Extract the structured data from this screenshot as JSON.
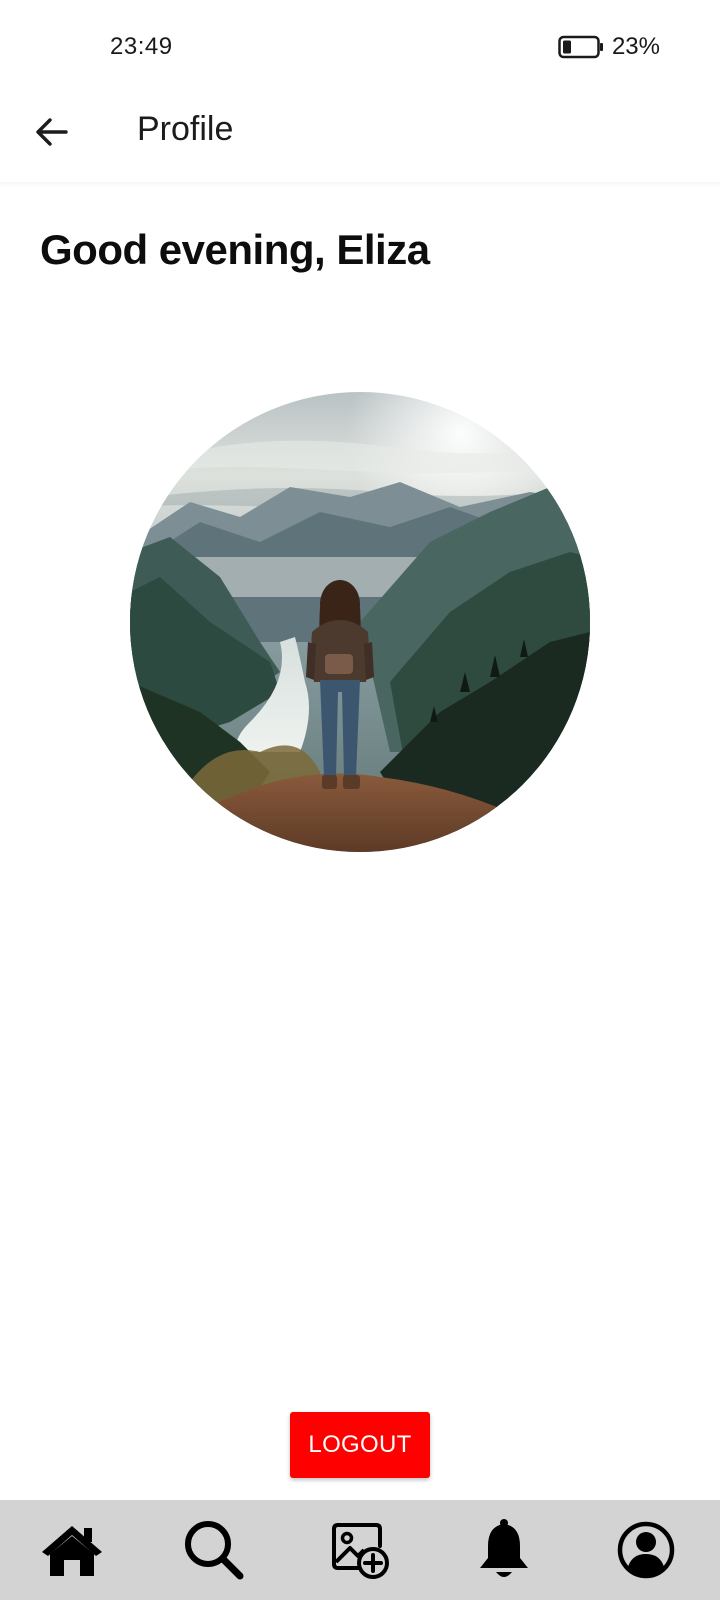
{
  "status_bar": {
    "time": "23:49",
    "battery_percent": "23%",
    "battery_level": 0.23
  },
  "header": {
    "back_icon": "arrow-left-icon",
    "title": "Profile"
  },
  "main": {
    "greeting": "Good evening, Eliza",
    "avatar_icon": "profile-photo"
  },
  "actions": {
    "logout_label": "LOGOUT",
    "logout_color": "#ff0000"
  },
  "bottom_nav": {
    "background": "#d3d3d3",
    "items": [
      {
        "icon": "home-icon"
      },
      {
        "icon": "search-icon"
      },
      {
        "icon": "add-image-icon"
      },
      {
        "icon": "bell-icon"
      },
      {
        "icon": "account-icon"
      }
    ]
  }
}
